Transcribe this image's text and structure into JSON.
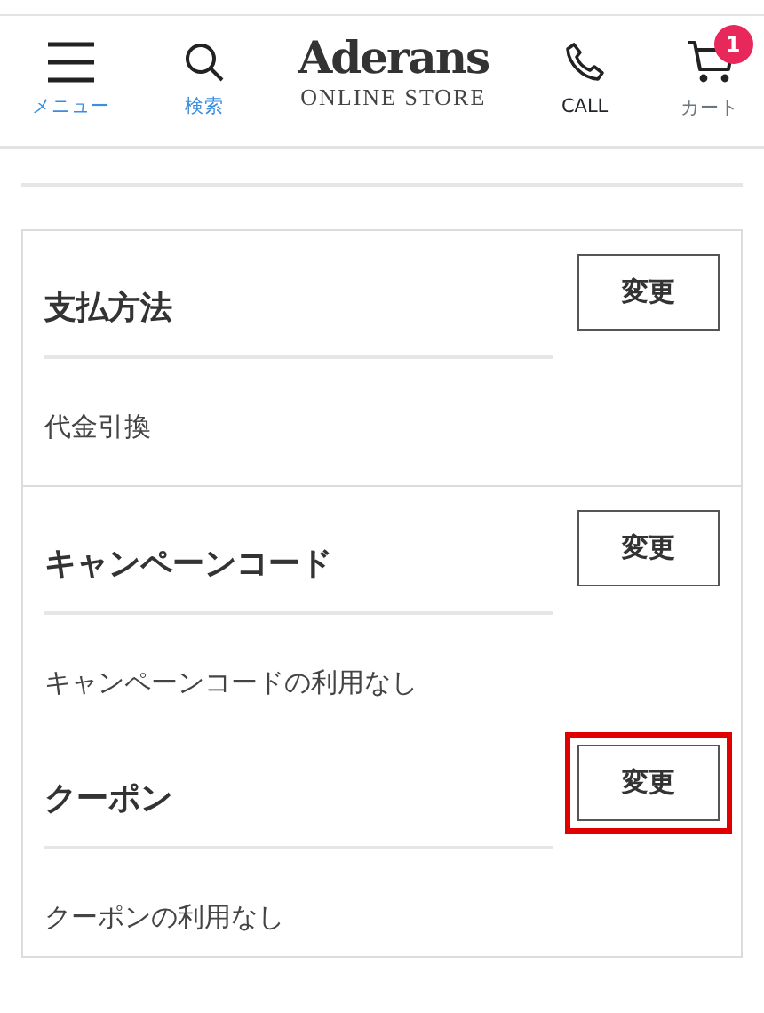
{
  "header": {
    "menu_label": "メニュー",
    "search_label": "検索",
    "logo": {
      "name": "Aderans",
      "sub": "ONLINE STORE"
    },
    "call_label": "CALL",
    "cart_label": "カート",
    "cart_count": "1"
  },
  "groups": [
    {
      "sections": [
        {
          "title": "支払方法",
          "value": "代金引換",
          "button": "変更",
          "highlighted": false
        }
      ]
    },
    {
      "sections": [
        {
          "title": "キャンペーンコード",
          "value": "キャンペーンコードの利用なし",
          "button": "変更",
          "highlighted": false
        },
        {
          "title": "クーポン",
          "value": "クーポンの利用なし",
          "button": "変更",
          "highlighted": true
        }
      ]
    }
  ]
}
